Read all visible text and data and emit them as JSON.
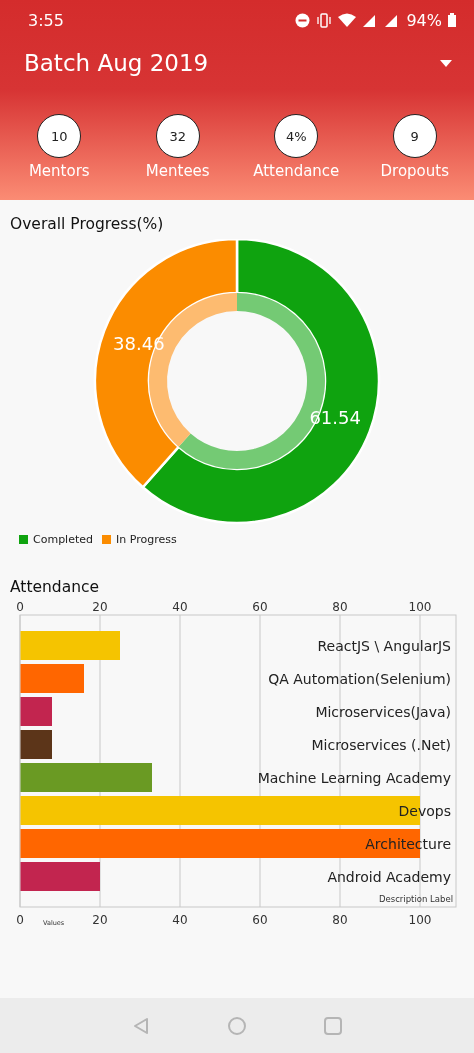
{
  "status_bar": {
    "time": "3:55",
    "battery": "94%"
  },
  "header": {
    "title": "Batch Aug 2019"
  },
  "stats": [
    {
      "value": "10",
      "label": "Mentors"
    },
    {
      "value": "32",
      "label": "Mentees"
    },
    {
      "value": "4%",
      "label": "Attendance"
    },
    {
      "value": "9",
      "label": "Dropouts"
    }
  ],
  "progress": {
    "title": "Overall Progress(%)",
    "chart_data": {
      "type": "donut",
      "categories": [
        "Completed",
        "In Progress"
      ],
      "value_labels": [
        "61.54",
        "38.46"
      ],
      "series": [
        {
          "values": [
            61.54,
            38.46
          ],
          "colors": [
            "#0fa30f",
            "#fb8c00"
          ]
        },
        {
          "values": [
            61.54,
            38.46
          ],
          "colors": [
            "#74ca74",
            "#fdbb70"
          ]
        }
      ]
    }
  },
  "attendance": {
    "title": "Attendance",
    "chart_data": {
      "type": "bar",
      "orientation": "horizontal",
      "title": "Description Label",
      "grid": true,
      "xlim": [
        0,
        109
      ],
      "xticks": [
        0,
        20,
        40,
        60,
        80,
        100
      ],
      "annotations": [
        "0",
        "20",
        "40",
        "60",
        "80",
        "100"
      ],
      "categories": [
        "ReactJS \\ AngularJS",
        "QA Automation(Selenium)",
        "Microservices(Java)",
        "Microservices (.Net)",
        "Machine Learning Academy",
        "Devops",
        "Architecture",
        "Android Academy"
      ],
      "series": [
        {
          "name": "Values",
          "values": [
            25,
            16,
            8,
            8,
            33,
            100,
            100,
            20
          ]
        }
      ],
      "colors": [
        "#f5c400",
        "#ff6600",
        "#c2254f",
        "#5c3519",
        "#6a9a23",
        "#f5c400",
        "#ff6600",
        "#c2254f"
      ]
    }
  }
}
